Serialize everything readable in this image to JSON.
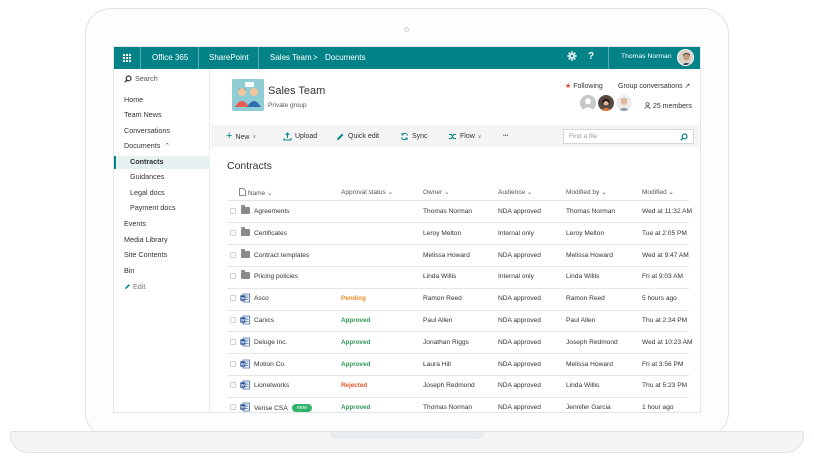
{
  "topbar": {
    "app": "Office 365",
    "suite": "SharePoint",
    "crumb_site": "Sales Team",
    "crumb_sep": ">",
    "crumb_page": "Documents",
    "settings_icon": "gear-icon",
    "help": "?",
    "user": "Thomas Norman"
  },
  "nav": {
    "search": "Search",
    "items": {
      "home": "Home",
      "news": "Team News",
      "conversations": "Conversations",
      "documents": "Documents",
      "contracts": "Contracts",
      "guidances": "Guidances",
      "legal": "Legal docs",
      "payment": "Payment docs",
      "events": "Events",
      "media": "Media Library",
      "site": "Site Contents",
      "bin": "Bin",
      "edit": "Edit"
    }
  },
  "site": {
    "title": "Sales Team",
    "subtitle": "Private group",
    "following": "Following",
    "group_conversations": "Group conversations",
    "members": "25 members"
  },
  "commands": {
    "new": "New",
    "upload": "Upload",
    "quick_edit": "Quick edit",
    "sync": "Sync",
    "flow": "Flow",
    "more": "•••",
    "find_placeholder": "Find a file"
  },
  "list": {
    "title": "Contracts",
    "headers": {
      "name": "Name",
      "status": "Approval status",
      "owner": "Owner",
      "audience": "Audience",
      "modified_by": "Modified by",
      "modified": "Modified"
    },
    "rows": [
      {
        "type": "folder",
        "name": "Agreements",
        "status": "",
        "owner": "Thomas Norman",
        "audience": "NDA approved",
        "modified_by": "Thomas Norman",
        "modified": "Wed at 11:32 AM"
      },
      {
        "type": "folder",
        "name": "Certificates",
        "status": "",
        "owner": "Leroy Melton",
        "audience": "Internal only",
        "modified_by": "Leroy Melton",
        "modified": "Tue at 2:05 PM"
      },
      {
        "type": "folder",
        "name": "Contract templates",
        "status": "",
        "owner": "Melissa Howard",
        "audience": "NDA approved",
        "modified_by": "Melissa Howard",
        "modified": "Wed at 9:47 AM"
      },
      {
        "type": "folder",
        "name": "Pricing policies",
        "status": "",
        "owner": "Linda Willis",
        "audience": "Internal only",
        "modified_by": "Linda Willis",
        "modified": "Fri at 9:03 AM"
      },
      {
        "type": "word",
        "name": "Asco",
        "status": "Pending",
        "owner": "Ramon Reed",
        "audience": "NDA approved",
        "modified_by": "Ramon Reed",
        "modified": "5 hours ago"
      },
      {
        "type": "word",
        "name": "Canics",
        "status": "Approved",
        "owner": "Paul Allen",
        "audience": "NDA approved",
        "modified_by": "Paul Allen",
        "modified": "Thu at 2:34 PM"
      },
      {
        "type": "word",
        "name": "Deluge Inc.",
        "status": "Approved",
        "owner": "Jonathan Riggs",
        "audience": "NDA approved",
        "modified_by": "Joseph Redmond",
        "modified": "Wed at 10:23 AM"
      },
      {
        "type": "word",
        "name": "Motion Co.",
        "status": "Approved",
        "owner": "Laura Hill",
        "audience": "NDA approved",
        "modified_by": "Melissa Howard",
        "modified": "Fri at 3:56 PM"
      },
      {
        "type": "word",
        "name": "Lionetworks",
        "status": "Rejected",
        "owner": "Joseph Redmond",
        "audience": "NDA approved",
        "modified_by": "Linda Willis",
        "modified": "Thu at 5:23 PM"
      },
      {
        "type": "word",
        "name": "Verise CSA",
        "badge": "new",
        "status": "Approved",
        "owner": "Thomas Norman",
        "audience": "NDA approved",
        "modified_by": "Jennifer Garcia",
        "modified": "1 hour ago"
      }
    ]
  },
  "colors": {
    "brand": "#038387",
    "pending": "#f08a1c",
    "approved": "#2d9b55",
    "rejected": "#e0532d"
  }
}
